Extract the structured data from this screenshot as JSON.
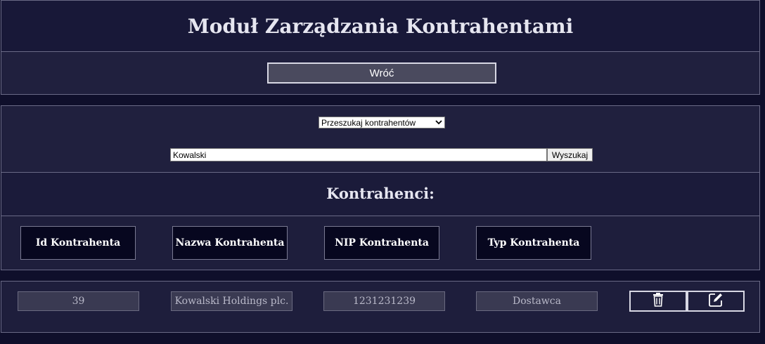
{
  "header": {
    "title": "Moduł Zarządzania Kontrahentami"
  },
  "nav": {
    "back_label": "Wróć"
  },
  "search": {
    "mode_selected": "Przeszukaj kontrahentów",
    "query_value": "Kowalski",
    "button_label": "Wyszukaj"
  },
  "list": {
    "title": "Kontrahenci:",
    "columns": [
      "Id Kontrahenta",
      "Nazwa Kontrahenta",
      "NIP Kontrahenta",
      "Typ Kontrahenta"
    ],
    "rows": [
      {
        "id": "39",
        "name": "Kowalski Holdings plc.",
        "nip": "1231231239",
        "type": "Dostawca",
        "actions": [
          "trash-icon",
          "edit-icon"
        ]
      }
    ]
  },
  "colors": {
    "background": "#0f0f2b",
    "panel": "#1e1e3c",
    "header_cell": "#07071f",
    "border": "#6a6a86"
  }
}
